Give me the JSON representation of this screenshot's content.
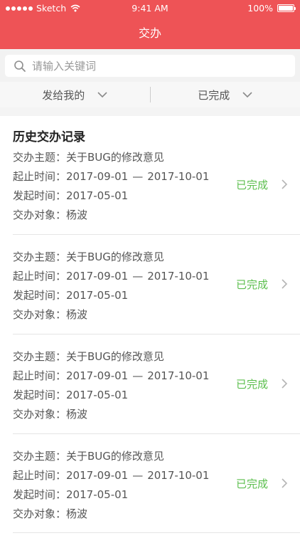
{
  "status_bar": {
    "carrier": "Sketch",
    "time": "9:41 AM",
    "battery": "100%"
  },
  "nav": {
    "title": "交办"
  },
  "search": {
    "placeholder": "请输入关键词"
  },
  "filters": [
    {
      "label": "发给我的"
    },
    {
      "label": "已完成"
    }
  ],
  "history": {
    "title": "历史交办记录",
    "labels": {
      "topic": "交办主题：",
      "period": "起止时间：",
      "start": "发起时间：",
      "target": "交办对象："
    },
    "range_separator": "—",
    "records": [
      {
        "topic": "关于BUG的修改意见",
        "period_start": "2017-09-01",
        "period_end": "2017-10-01",
        "initiated": "2017-05-01",
        "target": "杨波",
        "status": "已完成"
      },
      {
        "topic": "关于BUG的修改意见",
        "period_start": "2017-09-01",
        "period_end": "2017-10-01",
        "initiated": "2017-05-01",
        "target": "杨波",
        "status": "已完成"
      },
      {
        "topic": "关于BUG的修改意见",
        "period_start": "2017-09-01",
        "period_end": "2017-10-01",
        "initiated": "2017-05-01",
        "target": "杨波",
        "status": "已完成"
      },
      {
        "topic": "关于BUG的修改意见",
        "period_start": "2017-09-01",
        "period_end": "2017-10-01",
        "initiated": "2017-05-01",
        "target": "杨波",
        "status": "已完成"
      }
    ]
  },
  "colors": {
    "header": "#ee5356",
    "status_done": "#5cbf4e"
  }
}
